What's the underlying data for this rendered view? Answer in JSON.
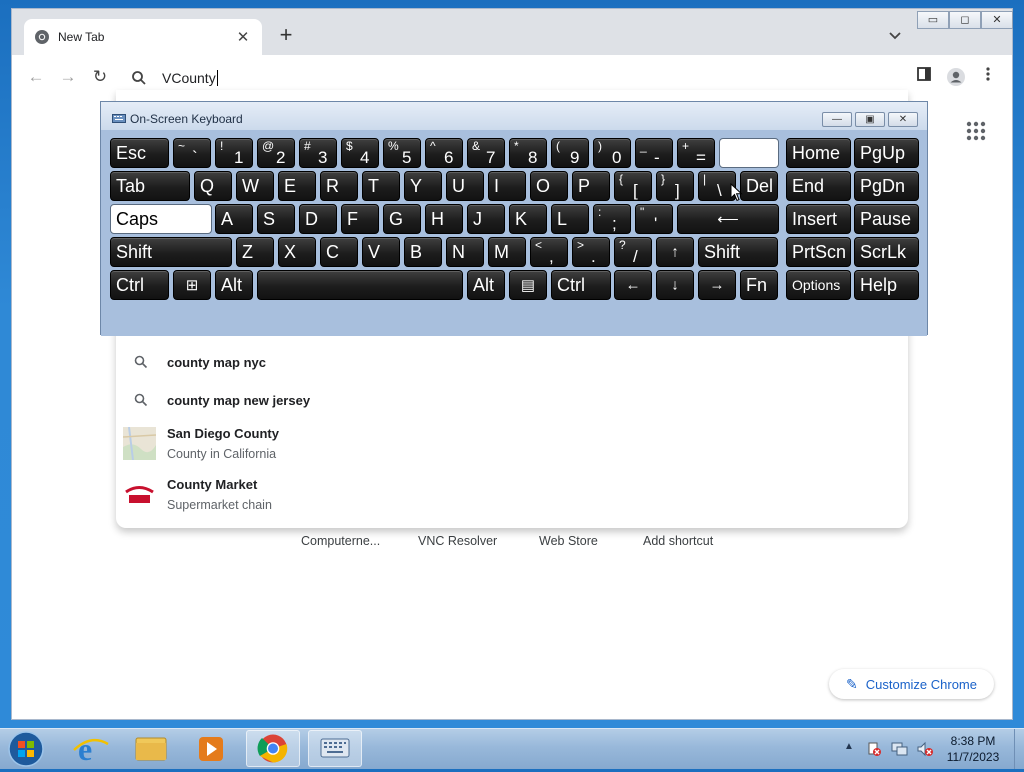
{
  "browser": {
    "tab_title": "New Tab",
    "tab_close": "✕",
    "new_tab": "+",
    "omnibox_text": "VCounty",
    "window_controls": [
      "▭",
      "◻",
      "✕"
    ]
  },
  "page": {
    "shortcuts": [
      "Computerne...",
      "VNC Resolver",
      "Web Store",
      "Add shortcut"
    ],
    "customize_label": "Customize Chrome"
  },
  "suggestions": [
    {
      "main": "county map nyc",
      "sub": "",
      "icon": "search-icon"
    },
    {
      "main": "county map new jersey",
      "sub": "",
      "icon": "search-icon"
    },
    {
      "main": "San Diego County",
      "sub": "County in California",
      "icon": "map-thumbnail"
    },
    {
      "main": "County Market",
      "sub": "Supermarket chain",
      "icon": "county-market-logo"
    }
  ],
  "osk": {
    "title": "On-Screen Keyboard",
    "rows": [
      [
        {
          "label": "Esc"
        },
        {
          "shift": "~",
          "main": "`"
        },
        {
          "shift": "!",
          "main": "1"
        },
        {
          "shift": "@",
          "main": "2"
        },
        {
          "shift": "#",
          "main": "3"
        },
        {
          "shift": "$",
          "main": "4"
        },
        {
          "shift": "%",
          "main": "5"
        },
        {
          "shift": "^",
          "main": "6"
        },
        {
          "shift": "&",
          "main": "7"
        },
        {
          "shift": "*",
          "main": "8"
        },
        {
          "shift": "(",
          "main": "9"
        },
        {
          "shift": ")",
          "main": "0"
        },
        {
          "shift": "_",
          "main": "-"
        },
        {
          "shift": "+",
          "main": "="
        },
        {
          "label": ""
        },
        {
          "label": "Home"
        },
        {
          "label": "PgUp"
        }
      ],
      [
        {
          "label": "Tab"
        },
        {
          "label": "Q"
        },
        {
          "label": "W"
        },
        {
          "label": "E"
        },
        {
          "label": "R"
        },
        {
          "label": "T"
        },
        {
          "label": "Y"
        },
        {
          "label": "U"
        },
        {
          "label": "I"
        },
        {
          "label": "O"
        },
        {
          "label": "P"
        },
        {
          "shift": "{",
          "main": "["
        },
        {
          "shift": "}",
          "main": "]"
        },
        {
          "shift": "|",
          "main": "\\"
        },
        {
          "label": "Del"
        },
        {
          "label": "End"
        },
        {
          "label": "PgDn"
        }
      ],
      [
        {
          "label": "Caps"
        },
        {
          "label": "A"
        },
        {
          "label": "S"
        },
        {
          "label": "D"
        },
        {
          "label": "F"
        },
        {
          "label": "G"
        },
        {
          "label": "H"
        },
        {
          "label": "J"
        },
        {
          "label": "K"
        },
        {
          "label": "L"
        },
        {
          "shift": ":",
          "main": ";"
        },
        {
          "shift": "\"",
          "main": "'"
        },
        {
          "label": "⟵"
        },
        {
          "label": "Insert"
        },
        {
          "label": "Pause"
        }
      ],
      [
        {
          "label": "Shift"
        },
        {
          "label": "Z"
        },
        {
          "label": "X"
        },
        {
          "label": "C"
        },
        {
          "label": "V"
        },
        {
          "label": "B"
        },
        {
          "label": "N"
        },
        {
          "label": "M"
        },
        {
          "shift": "<",
          "main": ","
        },
        {
          "shift": ">",
          "main": "."
        },
        {
          "shift": "?",
          "main": "/"
        },
        {
          "label": "↑"
        },
        {
          "label": "Shift"
        },
        {
          "label": "PrtScn"
        },
        {
          "label": "ScrLk"
        }
      ],
      [
        {
          "label": "Ctrl"
        },
        {
          "label": "⊞"
        },
        {
          "label": "Alt"
        },
        {
          "label": ""
        },
        {
          "label": "Alt"
        },
        {
          "label": "▤"
        },
        {
          "label": "Ctrl"
        },
        {
          "label": "←"
        },
        {
          "label": "↓"
        },
        {
          "label": "→"
        },
        {
          "label": "Fn"
        },
        {
          "label": "Options"
        },
        {
          "label": "Help"
        }
      ]
    ]
  },
  "taskbar": {
    "apps": [
      "Internet Explorer",
      "Windows Explorer",
      "Media Player",
      "Google Chrome",
      "On-Screen Keyboard"
    ],
    "time": "8:38 PM",
    "date": "11/7/2023"
  },
  "colors": {
    "desktop": "#2f89d6",
    "key_dark": "#1d1d1d",
    "accent": "#1a62c9"
  }
}
